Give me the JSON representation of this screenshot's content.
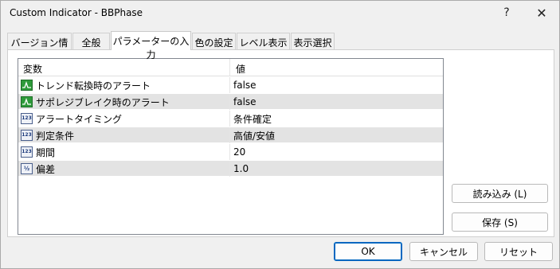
{
  "window": {
    "title": "Custom Indicator - BBPhase",
    "help_glyph": "?",
    "close_glyph": "✕"
  },
  "tabs": [
    {
      "label": "バージョン情報"
    },
    {
      "label": "全般"
    },
    {
      "label": "パラメーターの入力"
    },
    {
      "label": "色の設定"
    },
    {
      "label": "レベル表示"
    },
    {
      "label": "表示選択"
    }
  ],
  "active_tab": "パラメーターの入力",
  "grid": {
    "headers": [
      "変数",
      "値"
    ],
    "rows": [
      {
        "icon": "bool-icon",
        "name": "トレンド転換時のアラート",
        "value": "false"
      },
      {
        "icon": "bool-icon",
        "name": "サポレジブレイク時のアラート",
        "value": "false"
      },
      {
        "icon": "int-icon",
        "icon_text": "123",
        "name": "アラートタイミング",
        "value": "条件確定"
      },
      {
        "icon": "int-icon",
        "icon_text": "123",
        "name": "判定条件",
        "value": "高値/安値"
      },
      {
        "icon": "int-icon",
        "icon_text": "123",
        "name": "期間",
        "value": "20"
      },
      {
        "icon": "double-icon",
        "icon_text": "½",
        "name": "偏差",
        "value": "1.0"
      }
    ]
  },
  "side_buttons": {
    "load": "読み込み (L)",
    "save": "保存 (S)"
  },
  "footer": {
    "ok": "OK",
    "cancel": "キャンセル",
    "reset": "リセット"
  },
  "colors": {
    "bool_icon": "#2e9a3a",
    "ok_border": "#0067c0",
    "alt_row": "#e3e3e3"
  }
}
